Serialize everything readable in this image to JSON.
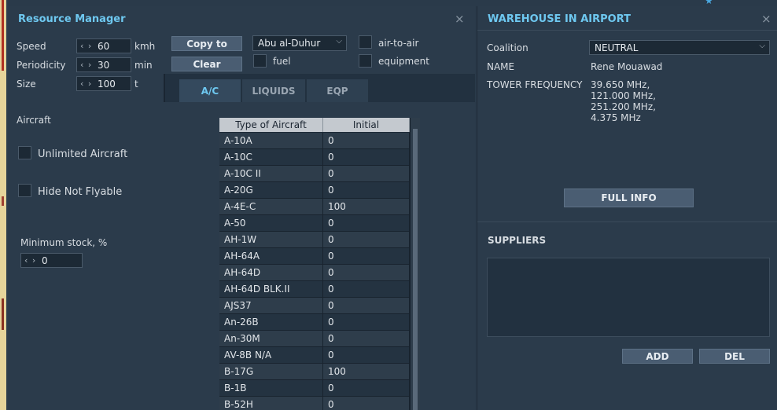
{
  "resource_manager": {
    "title": "Resource Manager",
    "close_glyph": "×",
    "speed": {
      "label": "Speed",
      "value": "60",
      "unit": "kmh"
    },
    "periodicity": {
      "label": "Periodicity",
      "value": "30",
      "unit": "min"
    },
    "size": {
      "label": "Size",
      "value": "100",
      "unit": "t"
    },
    "spinner_arrows": "‹ ›",
    "copy_to_label": "Copy to",
    "clear_label": "Clear",
    "airfield_select": "Abu al-Duhur",
    "checkboxes": {
      "air_to_air": "air-to-air",
      "fuel": "fuel",
      "equipment": "equipment"
    },
    "tabs": {
      "ac": "A/C",
      "liquids": "LIQUIDS",
      "eqp": "EQP"
    },
    "aircraft_heading": "Aircraft",
    "unlimited_aircraft": "Unlimited Aircraft",
    "hide_not_flyable": "Hide Not Flyable",
    "minimum_stock": {
      "label": "Minimum stock, %",
      "value": "0"
    },
    "table": {
      "headers": [
        "Type of Aircraft",
        "Initial"
      ],
      "rows": [
        [
          "A-10A",
          "0"
        ],
        [
          "A-10C",
          "0"
        ],
        [
          "A-10C II",
          "0"
        ],
        [
          "A-20G",
          "0"
        ],
        [
          "A-4E-C",
          "100"
        ],
        [
          "A-50",
          "0"
        ],
        [
          "AH-1W",
          "0"
        ],
        [
          "AH-64A",
          "0"
        ],
        [
          "AH-64D",
          "0"
        ],
        [
          "AH-64D BLK.II",
          "0"
        ],
        [
          "AJS37",
          "0"
        ],
        [
          "An-26B",
          "0"
        ],
        [
          "An-30M",
          "0"
        ],
        [
          "AV-8B N/A",
          "0"
        ],
        [
          "B-17G",
          "100"
        ],
        [
          "B-1B",
          "0"
        ],
        [
          "B-52H",
          "0"
        ]
      ]
    }
  },
  "warehouse": {
    "title": "WAREHOUSE IN AIRPORT",
    "close_glyph": "×",
    "coalition": {
      "label": "Coalition",
      "value": "NEUTRAL"
    },
    "name": {
      "label": "NAME",
      "value": "Rene Mouawad"
    },
    "tower_frequency": {
      "label": "TOWER FREQUENCY",
      "values": [
        "39.650 MHz,",
        "121.000 MHz,",
        "251.200 MHz,",
        "4.375 MHz"
      ]
    },
    "full_info_label": "FULL INFO",
    "suppliers_heading": "SUPPLIERS",
    "add_label": "ADD",
    "del_label": "DEL"
  },
  "colors": {
    "accent": "#6ec8f0",
    "panel": "#2b3b4b",
    "button": "#4a5d72"
  }
}
